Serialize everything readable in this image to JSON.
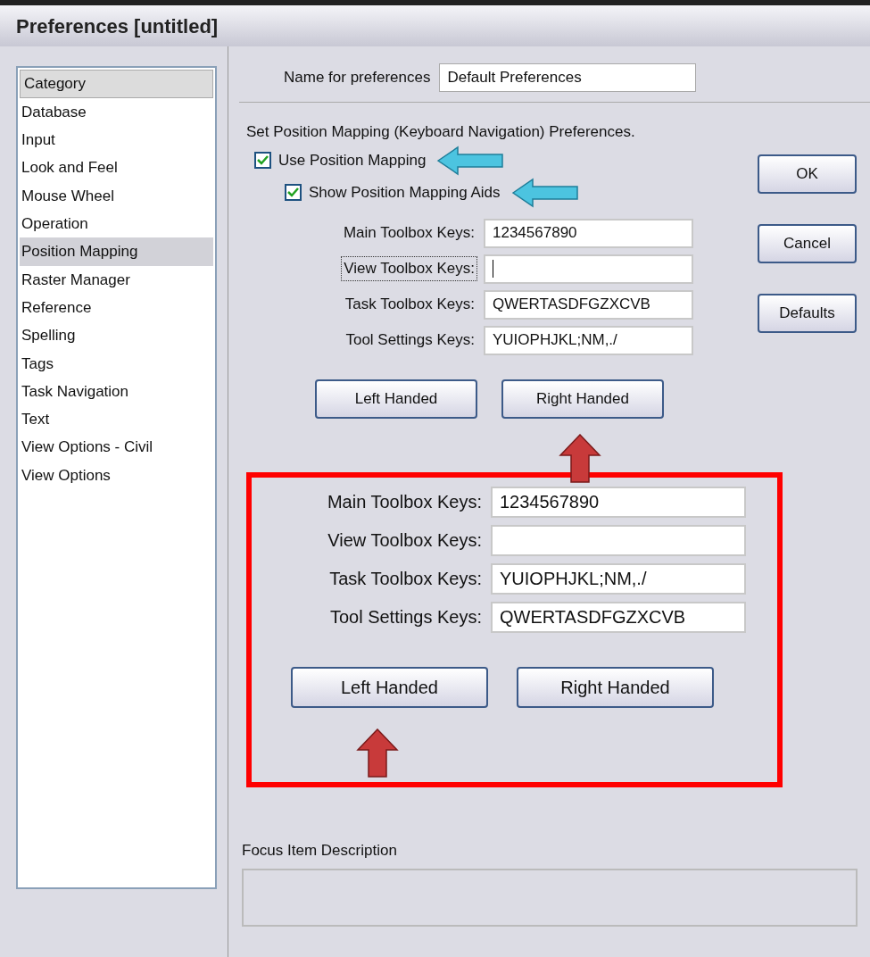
{
  "window": {
    "title": "Preferences [untitled]"
  },
  "sidebar": {
    "header": "Category",
    "items": [
      {
        "label": "Database",
        "selected": false
      },
      {
        "label": "Input",
        "selected": false
      },
      {
        "label": "Look and Feel",
        "selected": false
      },
      {
        "label": "Mouse Wheel",
        "selected": false
      },
      {
        "label": "Operation",
        "selected": false
      },
      {
        "label": "Position Mapping",
        "selected": true
      },
      {
        "label": "Raster Manager",
        "selected": false
      },
      {
        "label": "Reference",
        "selected": false
      },
      {
        "label": "Spelling",
        "selected": false
      },
      {
        "label": "Tags",
        "selected": false
      },
      {
        "label": "Task Navigation",
        "selected": false
      },
      {
        "label": "Text",
        "selected": false
      },
      {
        "label": "View Options - Civil",
        "selected": false
      },
      {
        "label": "View Options",
        "selected": false
      }
    ]
  },
  "name_field": {
    "label": "Name for preferences",
    "value": "Default Preferences"
  },
  "section_title": "Set Position Mapping (Keyboard Navigation) Preferences.",
  "checkboxes": [
    {
      "label": "Use Position Mapping",
      "checked": true
    },
    {
      "label": "Show Position Mapping Aids",
      "checked": true
    }
  ],
  "key_fields": [
    {
      "label": "Main Toolbox Keys:",
      "value": "1234567890",
      "focused": false
    },
    {
      "label": "View Toolbox Keys:",
      "focused": true
    },
    {
      "label": "Task Toolbox Keys:",
      "value": "QWERTASDFGZXCVB",
      "focused": false
    },
    {
      "label": "Tool Settings Keys:",
      "value": "YUIOPHJKL;NM,./",
      "focused": false
    }
  ],
  "hand_buttons": [
    "Left Handed",
    "Right Handed"
  ],
  "dialog_buttons": [
    "OK",
    "Cancel",
    "Defaults"
  ],
  "callout": {
    "key_fields": [
      {
        "label": "Main Toolbox Keys:",
        "value": "1234567890"
      },
      {
        "label": "View Toolbox Keys:"
      },
      {
        "label": "Task Toolbox Keys:",
        "value": "YUIOPHJKL;NM,./"
      },
      {
        "label": "Tool Settings Keys:",
        "value": "QWERTASDFGZXCVB"
      }
    ],
    "hand_buttons": [
      "Left Handed",
      "Right Handed"
    ]
  },
  "focus_description": {
    "label": "Focus Item Description"
  }
}
